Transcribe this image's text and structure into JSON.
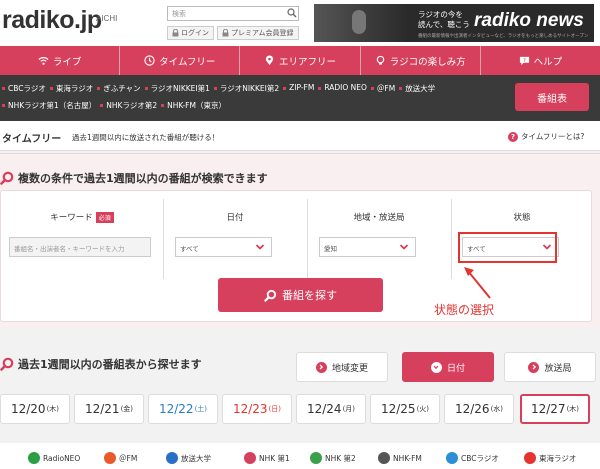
{
  "header": {
    "logo": "radiko.jp",
    "area": "AICHI",
    "search_placeholder": "検索",
    "login_label": "ログイン",
    "premium_label": "プレミアム会員登録",
    "banner_line1": "ラジオの今を",
    "banner_line2": "読んで、聴こう",
    "banner_brand": "radiko news",
    "banner_sub": "番組の最新情報や出演者インタビューなど、ラジオをもっと楽しめるサイトオープン"
  },
  "nav": {
    "items": [
      {
        "label": "ライブ",
        "icon": "wifi-icon"
      },
      {
        "label": "タイムフリー",
        "icon": "clock-icon"
      },
      {
        "label": "エリアフリー",
        "icon": "location-icon"
      },
      {
        "label": "ラジコの楽しみ方",
        "icon": "lightbulb-icon"
      },
      {
        "label": "ヘルプ",
        "icon": "help-icon"
      }
    ]
  },
  "stations": {
    "row1": [
      "CBCラジオ",
      "東海ラジオ",
      "ぎふチャン",
      "ラジオNIKKEI第1",
      "ラジオNIKKEI第2",
      "ZIP-FM",
      "RADIO NEO",
      "＠FM",
      "放送大学"
    ],
    "row2": [
      "NHKラジオ第1（名古屋）",
      "NHKラジオ第2",
      "NHK-FM（東京）"
    ],
    "program_button": "番組表"
  },
  "timefree": {
    "title": "タイムフリー",
    "description": "過去1週間以内に放送された番組が聴ける！",
    "help_link": "タイムフリーとは?"
  },
  "search_section": {
    "title": "複数の条件で過去1週間以内の番組が検索できます",
    "keyword_label": "キーワード",
    "required_badge": "必須",
    "keyword_placeholder": "番組名・出演者名・キーワードを入力",
    "date_label": "日付",
    "date_value": "すべて",
    "area_label": "地域・放送局",
    "area_value": "愛知",
    "state_label": "状態",
    "state_value": "すべて",
    "search_button": "番組を探す",
    "annotation": "状態の選択"
  },
  "schedule_section": {
    "title": "過去1週間以内の番組表から探せます",
    "toggles": [
      "地域変更",
      "日付",
      "放送局"
    ],
    "active_toggle": 1,
    "days": [
      {
        "date": "12/20",
        "dow": "(木)",
        "type": "weekday"
      },
      {
        "date": "12/21",
        "dow": "(金)",
        "type": "weekday"
      },
      {
        "date": "12/22",
        "dow": "(土)",
        "type": "sat"
      },
      {
        "date": "12/23",
        "dow": "(日)",
        "type": "sun"
      },
      {
        "date": "12/24",
        "dow": "(月)",
        "type": "weekday"
      },
      {
        "date": "12/25",
        "dow": "(火)",
        "type": "weekday"
      },
      {
        "date": "12/26",
        "dow": "(水)",
        "type": "weekday"
      },
      {
        "date": "12/27",
        "dow": "(木)",
        "type": "selected"
      }
    ],
    "logos": [
      {
        "label": "RadioNEO",
        "color": "#2aa043"
      },
      {
        "label": "＠FM",
        "color": "#e85a2a"
      },
      {
        "label": "放送大学",
        "color": "#2a6fc7"
      },
      {
        "label": "NHK 第1",
        "color": "#d6405d"
      },
      {
        "label": "NHK 第2",
        "color": "#3aa04a"
      },
      {
        "label": "NHK-FM",
        "color": "#555555"
      },
      {
        "label": "CBCラジオ",
        "color": "#2a8fd6"
      },
      {
        "label": "東海ラジオ",
        "color": "#e3342f"
      }
    ]
  },
  "colors": {
    "accent": "#d6405d",
    "dark_bar": "#3a3a3a",
    "annotation": "#e3342f"
  }
}
